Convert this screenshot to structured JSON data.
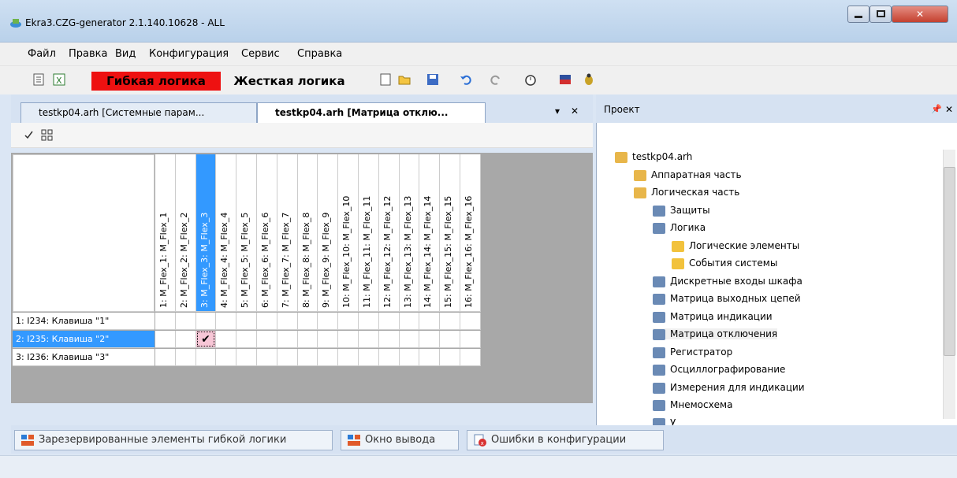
{
  "window": {
    "title": "Ekra3.CZG-generator 2.1.140.10628 - ALL"
  },
  "menu": [
    "Файл",
    "Правка",
    "Вид",
    "Конфигурация",
    "Сервис",
    "Справка"
  ],
  "toolbar": {
    "flex_logic": "Гибкая логика",
    "hard_logic": "Жесткая логика"
  },
  "tabs": [
    {
      "label": "testkp04.arh [Системные парам..."
    },
    {
      "label": "testkp04.arh [Матрица отклю..."
    }
  ],
  "tab_controls": {
    "menu": "▾",
    "close": "✕"
  },
  "matrix": {
    "columns": [
      "1: M_Flex_1: M_Flex_1",
      "2: M_Flex_2: M_Flex_2",
      "3: M_Flex_3: M_Flex_3",
      "4: M_Flex_4: M_Flex_4",
      "5: M_Flex_5: M_Flex_5",
      "6: M_Flex_6: M_Flex_6",
      "7: M_Flex_7: M_Flex_7",
      "8: M_Flex_8: M_Flex_8",
      "9: M_Flex_9: M_Flex_9",
      "10: M_Flex_10: M_Flex_10",
      "11: M_Flex_11: M_Flex_11",
      "12: M_Flex_12: M_Flex_12",
      "13: M_Flex_13: M_Flex_13",
      "14: M_Flex_14: M_Flex_14",
      "15: M_Flex_15: M_Flex_15",
      "16: M_Flex_16: M_Flex_16"
    ],
    "rows": [
      "1: I234:  Клавиша \"1\"",
      "2: I235:  Клавиша \"2\"",
      "3: I236:  Клавиша \"3\""
    ],
    "selected_row": 1,
    "selected_col": 2,
    "checked": [
      [
        1,
        2
      ]
    ],
    "check_glyph": "✔"
  },
  "bottom_tabs": [
    "Зарезервированные элементы гибкой логики",
    "Окно вывода",
    "Ошибки в конфигурации"
  ],
  "project": {
    "title": "Проект",
    "pin": "📌",
    "close": "✕",
    "tree": [
      {
        "label": "testkp04.arh",
        "level": 0
      },
      {
        "label": "Аппаратная часть",
        "level": 1
      },
      {
        "label": "Логическая часть",
        "level": 1
      },
      {
        "label": "Защиты",
        "level": 2
      },
      {
        "label": "Логика",
        "level": 2
      },
      {
        "label": "Логические элементы",
        "level": 3
      },
      {
        "label": "События системы",
        "level": 3
      },
      {
        "label": "Дискретные входы шкафа",
        "level": 2
      },
      {
        "label": "Матрица выходных цепей",
        "level": 2
      },
      {
        "label": "Матрица индикации",
        "level": 2
      },
      {
        "label": "Матрица отключения",
        "level": 2
      },
      {
        "label": "Регистратор",
        "level": 2
      },
      {
        "label": "Осциллографирование",
        "level": 2
      },
      {
        "label": "Измерения для индикации",
        "level": 2
      },
      {
        "label": "Мнемосхема",
        "level": 2
      },
      {
        "label": "У",
        "level": 2
      }
    ]
  }
}
